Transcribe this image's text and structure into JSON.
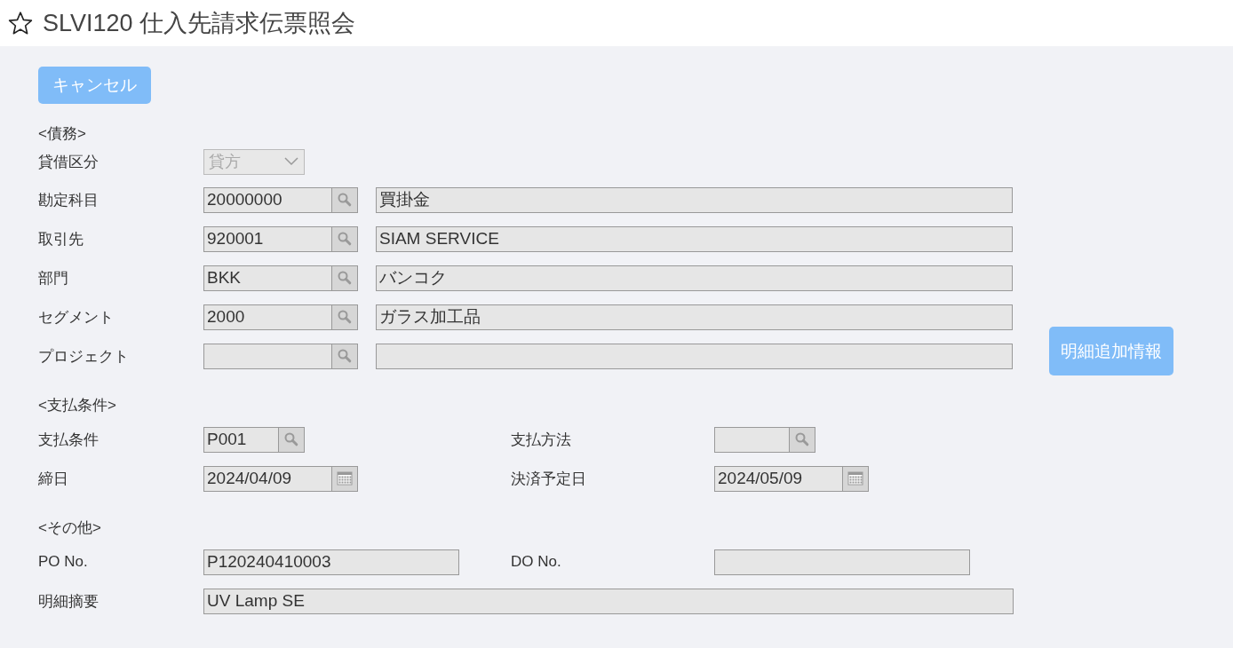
{
  "title": {
    "text": "SLVI120 仕入先請求伝票照会",
    "favorite": false
  },
  "cancel_button": "キャンセル",
  "sections": [
    {
      "heading": "<債務>",
      "rows": [
        [
          {
            "kind": "select",
            "label": "貸借区分",
            "value": "貸方",
            "disabled": true
          }
        ],
        [
          {
            "kind": "pair",
            "label": "勘定科目",
            "value": "20000000",
            "name": "買掛金"
          }
        ],
        [
          {
            "kind": "pair",
            "label": "取引先",
            "value": "920001",
            "name": "SIAM SERVICE"
          }
        ],
        [
          {
            "kind": "pair",
            "label": "部門",
            "value": "BKK",
            "name": "バンコク"
          }
        ],
        [
          {
            "kind": "pair",
            "label": "セグメント",
            "value": "2000",
            "name": "ガラス加工品"
          }
        ],
        [
          {
            "kind": "pair",
            "label": "プロジェクト"
          }
        ]
      ]
    },
    {
      "heading": "<支払条件>",
      "rows": [
        [
          {
            "kind": "lookup",
            "label": "支払条件",
            "value": "P001"
          },
          {
            "kind": "lookup",
            "label": "支払方法"
          }
        ],
        [
          {
            "kind": "date",
            "label": "締日",
            "value": "2024/04/09"
          },
          {
            "kind": "date",
            "label": "決済予定日",
            "value": "2024/05/09"
          }
        ]
      ]
    },
    {
      "heading": "<その他>",
      "rows": [
        [
          {
            "kind": "text",
            "label": "PO No.",
            "value": "P120240410003"
          },
          {
            "kind": "text",
            "label": "DO No."
          }
        ],
        [
          {
            "kind": "text",
            "label": "明細摘要",
            "value": "UV Lamp SE"
          }
        ]
      ]
    }
  ],
  "detail_button": "明細追加情報"
}
